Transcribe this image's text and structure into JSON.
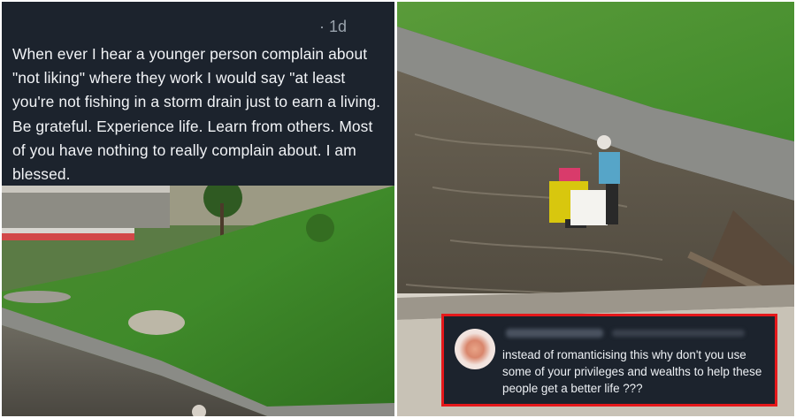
{
  "left_panel": {
    "post": {
      "timestamp": "· 1d",
      "text": "When ever I hear a younger person complain about \"not liking\" where they work I would say \"at least you're not fishing in a storm drain just to earn a living. Be grateful. Experience life. Learn from others. Most of you have nothing to really complain about. I am blessed."
    },
    "photo": {
      "description": ""
    }
  },
  "right_panel": {
    "comment": {
      "text": "instead of romanticising this why don't you use some of your privileges and wealths to help these people get a better life ???",
      "highlight_color": "#e5181b"
    }
  },
  "colors": {
    "post_background": "#1c232d",
    "text": "#f2f4f7",
    "timestamp": "#9aa3ad"
  }
}
